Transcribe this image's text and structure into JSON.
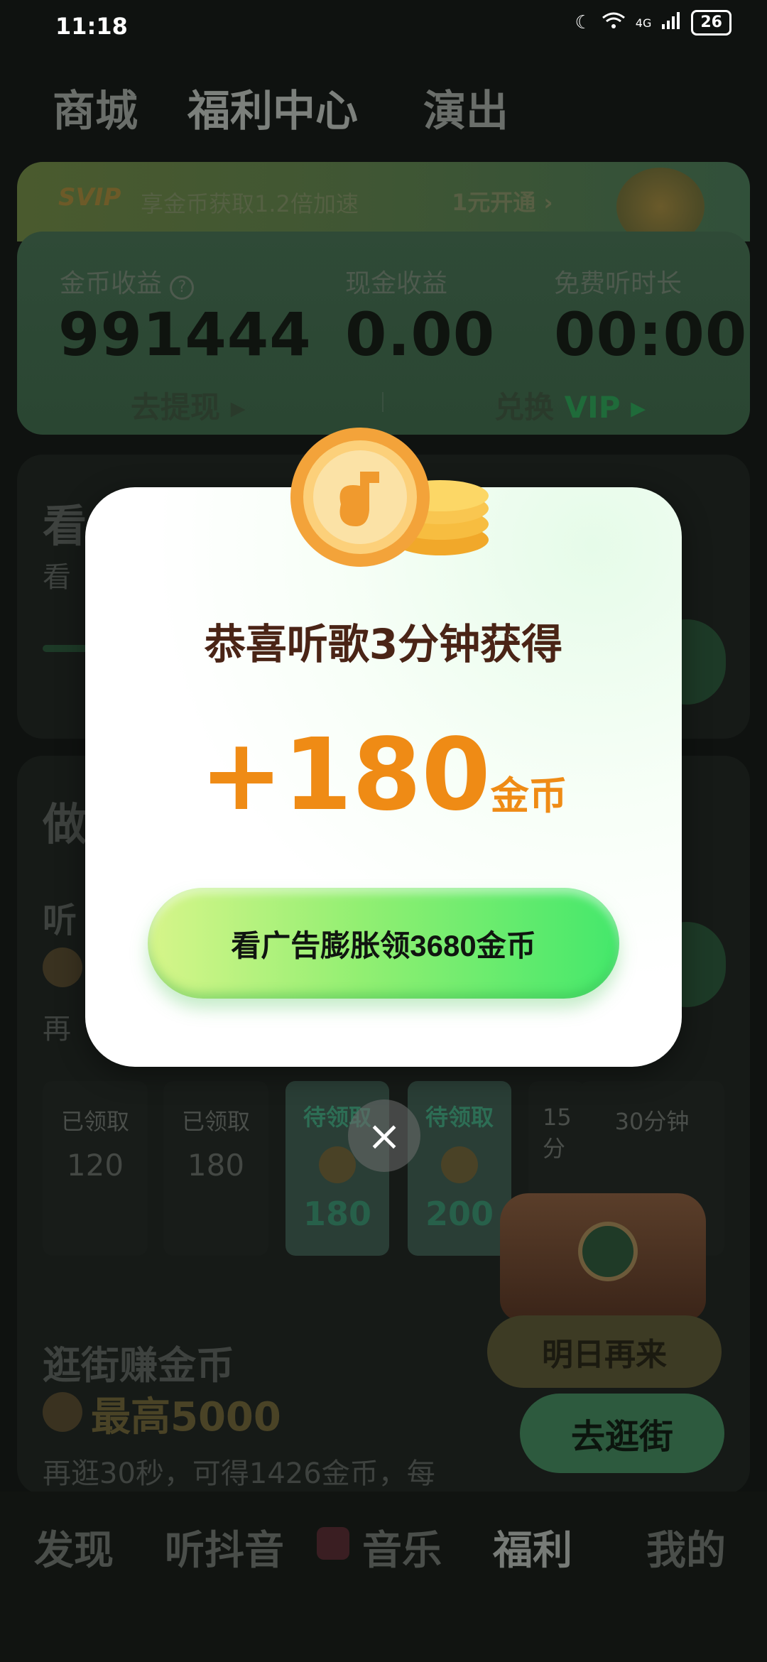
{
  "status_bar": {
    "time": "11:18",
    "network": "4G",
    "battery": "26"
  },
  "top_tabs": [
    "商城",
    "福利中心",
    "演出"
  ],
  "svip_banner": {
    "tag": "SVIP",
    "text": "享金币获取1.2倍加速",
    "action": "1元开通 ›"
  },
  "earnings": {
    "coins_label": "金币收益",
    "coins_value": "991444",
    "cash_label": "现金收益",
    "cash_value": "0.00",
    "free_label": "免费听时长",
    "free_value": "00:00",
    "withdraw_label": "去提现 ▸",
    "exchange_label": "兑换",
    "exchange_vip": "VIP ▸"
  },
  "background": {
    "section1_title": "看",
    "section1_sub": "看",
    "section2_title": "做",
    "section2_item": "听",
    "section2_hint": "再",
    "rewards": [
      {
        "status": "已领取",
        "amount": "120",
        "state": "claimed"
      },
      {
        "status": "已领取",
        "amount": "180",
        "state": "claimed"
      },
      {
        "status": "待领取",
        "amount": "180",
        "state": "pending"
      },
      {
        "status": "待领取",
        "amount": "200",
        "state": "pending"
      },
      {
        "status": "15分",
        "amount": "",
        "state": "locked"
      },
      {
        "status": "30分钟",
        "amount": "",
        "state": "locked"
      }
    ],
    "shop_title": "逛街赚金币",
    "shop_max": "最高5000",
    "shop_desc": "再逛30秒，可得1426金币，每",
    "tomorrow_label": "明日再来",
    "shop_button": "去逛街"
  },
  "bottom_nav": [
    "发现",
    "听抖音",
    "音乐",
    "福利",
    "我的"
  ],
  "modal": {
    "title": "恭喜听歌3分钟获得",
    "amount": "+180",
    "unit": "金币",
    "cta": "看广告膨胀领3680金币",
    "close": "×"
  }
}
